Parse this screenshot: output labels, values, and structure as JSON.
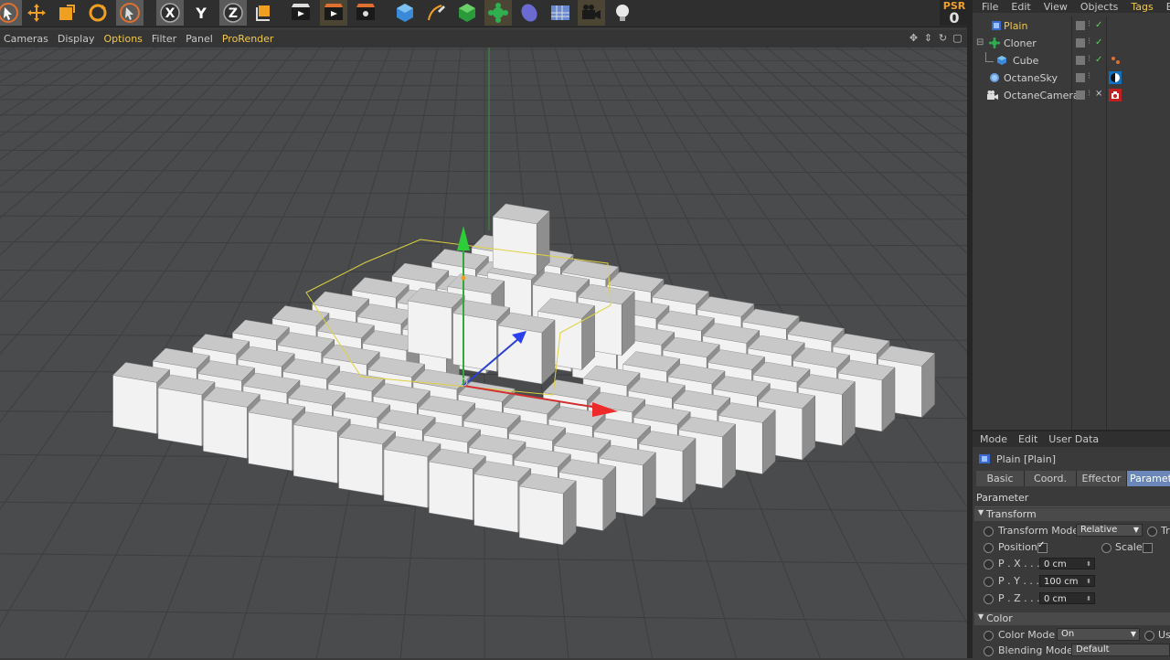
{
  "toolbar": {
    "psr_label": "PSR",
    "psr_value": "0",
    "axis_x": "X",
    "axis_y": "Y",
    "axis_z": "Z"
  },
  "viewport_menu": {
    "items": [
      "Cameras",
      "Display",
      "Options",
      "Filter",
      "Panel",
      "ProRender"
    ]
  },
  "object_manager": {
    "menu": [
      "File",
      "Edit",
      "View",
      "Objects",
      "Tags",
      "B"
    ],
    "objects": [
      {
        "name": "Plain",
        "icon": "plain-effector-icon"
      },
      {
        "name": "Cloner",
        "icon": "cloner-icon"
      },
      {
        "name": "Cube",
        "icon": "cube-icon"
      },
      {
        "name": "OctaneSky",
        "icon": "sky-icon"
      },
      {
        "name": "OctaneCamera",
        "icon": "camera-icon"
      }
    ]
  },
  "attribute_manager": {
    "menu": [
      "Mode",
      "Edit",
      "User Data"
    ],
    "title": "Plain [Plain]",
    "tabs": [
      "Basic",
      "Coord.",
      "Effector",
      "Paramete"
    ],
    "section": "Parameter",
    "transform_label": "Transform",
    "transform_mode_label": "Transform Mode",
    "transform_mode_value": "Relative",
    "transform_trunc": "Tr",
    "position_label": "Position",
    "scale_label": "Scale",
    "px_label": "P . X . . . .",
    "px_value": "0 cm",
    "py_label": "P . Y . . . .",
    "py_value": "100 cm",
    "pz_label": "P . Z . . . .",
    "pz_value": "0 cm",
    "color_label": "Color",
    "color_mode_label": "Color Mode",
    "color_mode_value": "On",
    "color_mode_trunc": "Us",
    "blending_label": "Blending Mode",
    "blending_value": "Default"
  },
  "colors": {
    "accent_yellow": "#f2c94c",
    "tab_active": "#6b86b8"
  }
}
